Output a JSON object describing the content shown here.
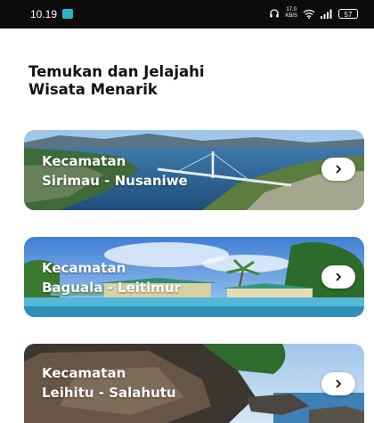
{
  "status_bar": {
    "time": "10.19",
    "net_speed": "17,0",
    "net_unit": "KB/S",
    "battery": "57"
  },
  "heading": {
    "line1": "Temukan dan Jelajahi",
    "line2": "Wisata Menarik"
  },
  "cards": [
    {
      "line1": "Kecamatan",
      "line2": "Sirimau - Nusaniwe",
      "icon": "chevron-right-icon"
    },
    {
      "line1": "Kecamatan",
      "line2": "Baguala - Leitimur",
      "icon": "chevron-right-icon"
    },
    {
      "line1": "Kecamatan",
      "line2": "Leihitu - Salahutu",
      "icon": "chevron-right-icon"
    }
  ]
}
